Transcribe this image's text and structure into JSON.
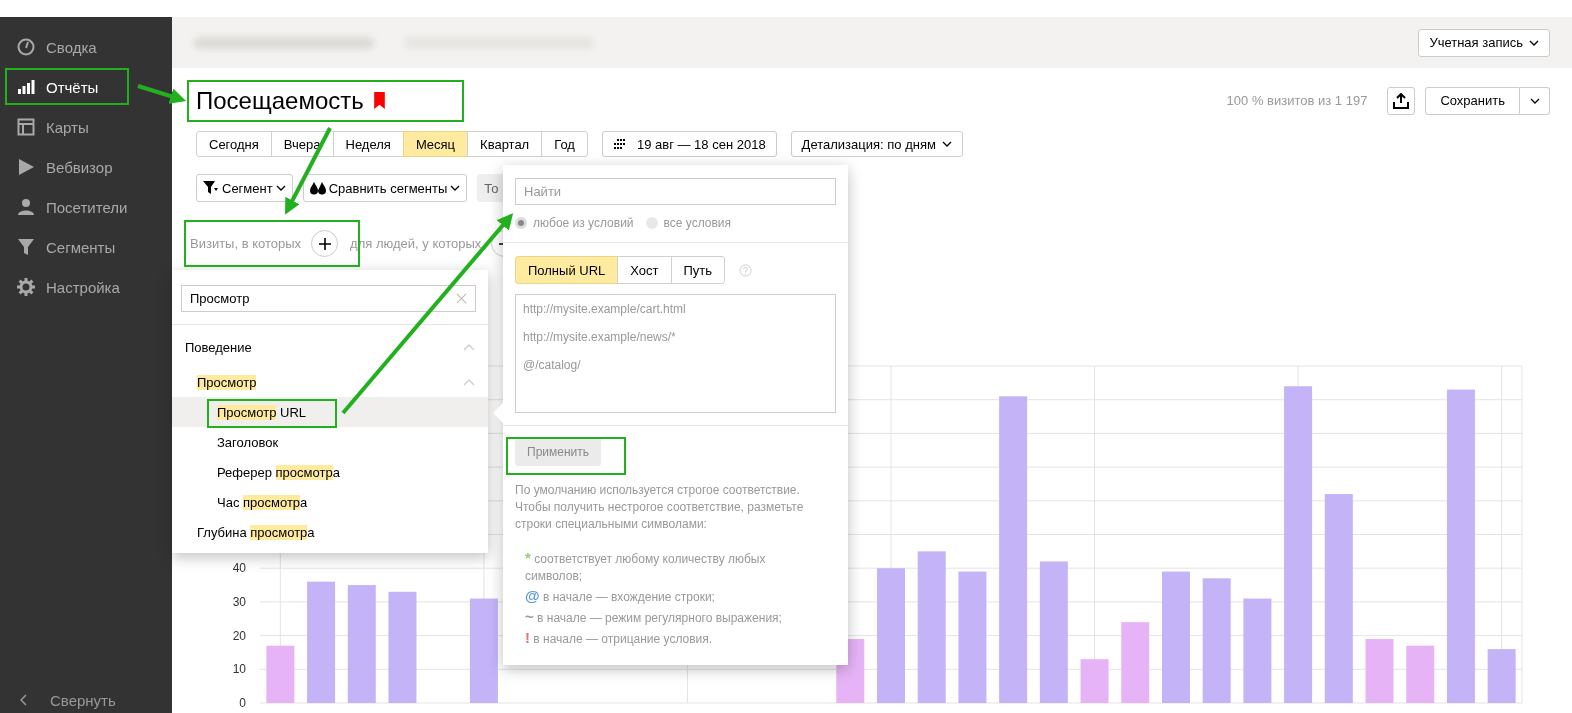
{
  "sidebar": {
    "items": [
      {
        "label": "Сводка",
        "selected": false
      },
      {
        "label": "Отчёты",
        "selected": true
      },
      {
        "label": "Карты",
        "selected": false
      },
      {
        "label": "Вебвизор",
        "selected": false
      },
      {
        "label": "Посетители",
        "selected": false
      },
      {
        "label": "Сегменты",
        "selected": false
      },
      {
        "label": "Настройка",
        "selected": false
      }
    ],
    "collapse": "Свернуть"
  },
  "header": {
    "account_button": "Учетная запись"
  },
  "report": {
    "title": "Посещаемость",
    "bookmarked": true,
    "share": "100 % визитов из 1 197",
    "save_button": "Сохранить"
  },
  "periods": [
    {
      "label": "Сегодня",
      "selected": false
    },
    {
      "label": "Вчера",
      "selected": false
    },
    {
      "label": "Неделя",
      "selected": false
    },
    {
      "label": "Месяц",
      "selected": true
    },
    {
      "label": "Квартал",
      "selected": false
    },
    {
      "label": "Год",
      "selected": false
    }
  ],
  "date_range": "19 авг — 18 сен 2018",
  "detail_button": "Детализация: по дням",
  "segment_buttons": [
    {
      "label": "Сегмент",
      "kind": "filter"
    },
    {
      "label": "Сравнить сегменты",
      "kind": "compare"
    },
    {
      "label": "То",
      "kind": "plain"
    }
  ],
  "condition_row": {
    "visits_label": "Визиты, в которых",
    "people_label": "для людей, у которых"
  },
  "attribute_menu": {
    "search": {
      "value": "Просмотр"
    },
    "tree": [
      {
        "parts": [
          {
            "text": "Поведение",
            "match": false
          }
        ],
        "expanded": true,
        "selected": false,
        "children": [
          {
            "parts": [
              {
                "text": "Просмотр",
                "match": true
              }
            ],
            "expanded": true,
            "selected": false,
            "children": [
              {
                "parts": [
                  {
                    "text": "Просмотр",
                    "match": true
                  },
                  {
                    "text": " URL",
                    "match": false
                  }
                ],
                "selected": true
              },
              {
                "parts": [
                  {
                    "text": "Заголовок",
                    "match": false
                  }
                ],
                "selected": false
              },
              {
                "parts": [
                  {
                    "text": "Реферер ",
                    "match": false
                  },
                  {
                    "text": "просмотр",
                    "match": true
                  },
                  {
                    "text": "а",
                    "match": false
                  }
                ],
                "selected": false
              },
              {
                "parts": [
                  {
                    "text": "Час ",
                    "match": false
                  },
                  {
                    "text": "просмотр",
                    "match": true
                  },
                  {
                    "text": "а",
                    "match": false
                  }
                ],
                "selected": false
              }
            ]
          },
          {
            "parts": [
              {
                "text": "Глубина ",
                "match": false
              },
              {
                "text": "просмотр",
                "match": true
              },
              {
                "text": "а",
                "match": false
              }
            ],
            "selected": false
          }
        ]
      }
    ]
  },
  "condition_popup": {
    "search": {
      "placeholder": "Найти"
    },
    "match_modes": [
      {
        "label": "любое из условий",
        "selected": true
      },
      {
        "label": "все условия",
        "selected": false
      }
    ],
    "url_tabs": [
      {
        "label": "Полный URL",
        "selected": true
      },
      {
        "label": "Хост",
        "selected": false
      },
      {
        "label": "Путь",
        "selected": false
      }
    ],
    "values_field": {
      "placeholder": "http://mysite.example/cart.html\nhttp://mysite.example/news/*\n@/catalog/"
    },
    "apply_button": "Применить",
    "help_text": "По умолчанию используется строгое соответствие. Чтобы получить нестрогое соответствие, разметьте строки специальными символами:",
    "rules": [
      {
        "symbol": "*",
        "color": "#9ccc65",
        "text": "соответствует любому количеству любых символов;"
      },
      {
        "symbol": "@",
        "color": "#5b9bd5",
        "text": "в начале — вхождение строки;"
      },
      {
        "symbol": "~",
        "color": "#999999",
        "text": "в начале — режим регулярного выражения;"
      },
      {
        "symbol": "!",
        "color": "#e57373",
        "text": "в начале — отрицание условия."
      }
    ]
  },
  "chart_data": {
    "type": "bar",
    "grid": true,
    "ylim": [
      0,
      100
    ],
    "yticks": [
      0,
      10,
      20,
      30,
      40
    ],
    "series": [
      {
        "color": "#c4b3f7",
        "values": [
          null,
          36,
          35,
          33,
          null,
          31,
          null,
          null,
          null,
          null,
          null,
          null,
          null,
          null,
          null,
          40,
          45,
          39,
          91,
          42,
          null,
          null,
          39,
          37,
          31,
          94,
          62,
          null,
          null,
          93,
          16
        ]
      },
      {
        "color": "#e6b3f7",
        "values": [
          17,
          null,
          null,
          null,
          null,
          null,
          null,
          null,
          null,
          null,
          null,
          null,
          null,
          null,
          19,
          null,
          null,
          null,
          null,
          null,
          13,
          24,
          null,
          null,
          null,
          null,
          null,
          19,
          17,
          null,
          null
        ]
      }
    ]
  }
}
